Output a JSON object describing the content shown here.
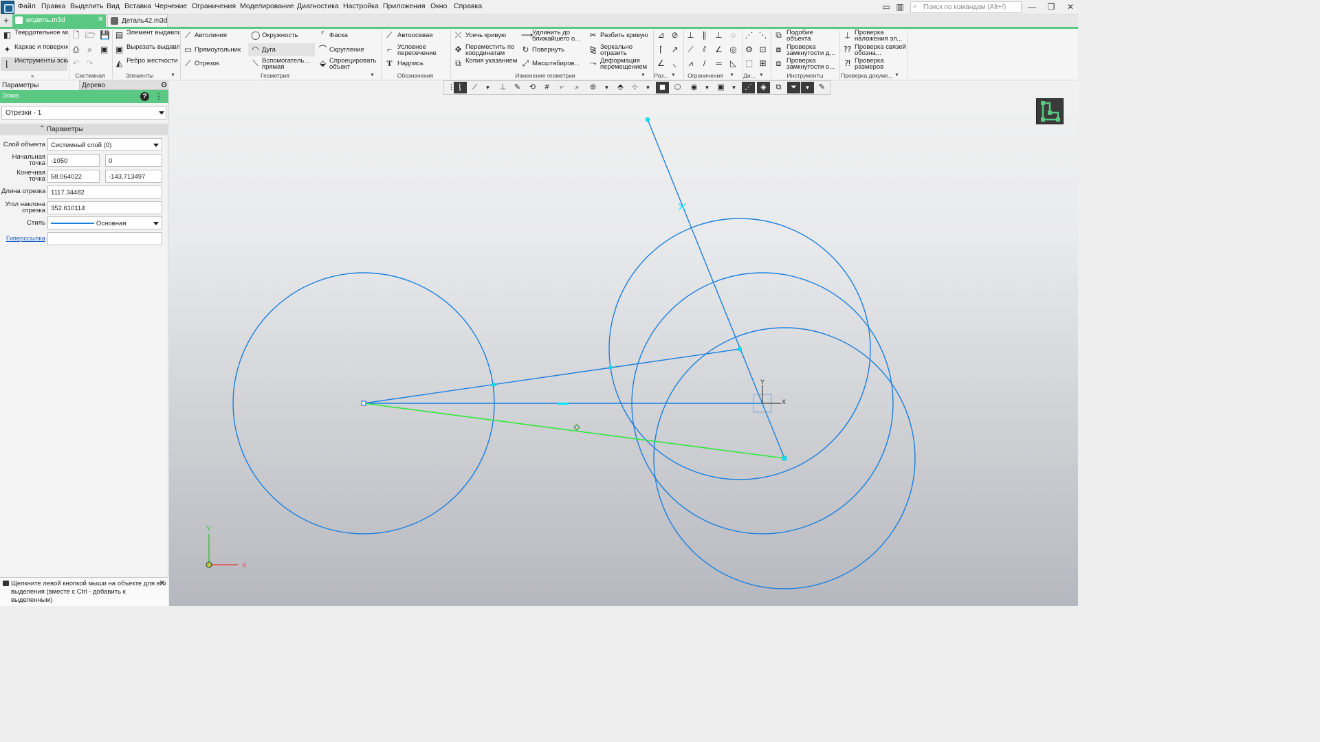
{
  "menu": [
    "Файл",
    "Правка",
    "Выделить",
    "Вид",
    "Вставка",
    "Черчение",
    "Ограничения",
    "Моделирование",
    "Диагностика",
    "Настройка",
    "Приложения",
    "Окно",
    "Справка"
  ],
  "search_placeholder": "Поиск по командам (Alt+/)",
  "tabs": [
    {
      "label": "модель.m3d",
      "active": true
    },
    {
      "label": "Деталь42.m3d",
      "active": false
    }
  ],
  "ribbon": {
    "modes": [
      "Твердотельное моделирование",
      "Каркас и поверхности",
      "Инструменты эскиза"
    ],
    "geometry": [
      "Автолиния",
      "Окружность",
      "Фаска",
      "Прямоугольник",
      "Дуга",
      "Скругление",
      "Отрезок",
      "Вспомогатель... прямая",
      "Спроецировать объект"
    ],
    "elements": [
      "Элемент выдавливания",
      "Вырезать выдавливанием",
      "Ребро жесткости"
    ],
    "designations": [
      "Автоосевая",
      "Условное пересечение",
      "Надпись"
    ],
    "edit_geometry": [
      "Усечь кривую",
      "Удлинить до ближайшего о...",
      "Разбить кривую",
      "Переместить по координатам",
      "Повернуть",
      "Зеркально отразить",
      "Копия указанием",
      "Масштабиров...",
      "Деформация перемещением"
    ],
    "tools": [
      "Подобие объекта",
      "Проверка замкнутости д...",
      "Проверка замкнутости о..."
    ],
    "doc_check": [
      "Проверка наложения эл...",
      "Проверка связей обозна...",
      "Проверка размеров"
    ],
    "group_labels": [
      "Системная",
      "Элементы",
      "Геометрия",
      "Обозначения",
      "Изменение геометрии",
      "Раз...",
      "Ограничения",
      "Ди...",
      "Инструменты",
      "Проверка докуме..."
    ]
  },
  "panel": {
    "tabs": [
      "Параметры",
      "Дерево"
    ],
    "sketch_title": "Эскиз",
    "object_select": "Отрезки - 1",
    "section_title": "Параметры",
    "fields": {
      "layer_label": "Слой объекта",
      "layer_value": "Системный слой (0)",
      "start_label": "Начальная точка",
      "start_x": "-1050",
      "start_y": "0",
      "end_label": "Конечная точка",
      "end_x": "58.064022",
      "end_y": "-143.713497",
      "length_label": "Длина отрезка",
      "length_value": "1117.34482",
      "angle_label": "Угол наклона отрезка",
      "angle_value": "352.610114",
      "style_label": "Стиль",
      "style_value": "Основная",
      "link_label": "Гиперссылка",
      "link_value": ""
    },
    "status": "Щелкните левой кнопкой мыши на объекте для его выделения (вместе с Ctrl - добавить к выделенным)"
  },
  "axes": {
    "x": "X",
    "y": "Y"
  },
  "colors": {
    "accent": "#5ac883",
    "sketch": "#1a7fe0",
    "selected": "#2ee83a",
    "points": "#00e5ff"
  }
}
